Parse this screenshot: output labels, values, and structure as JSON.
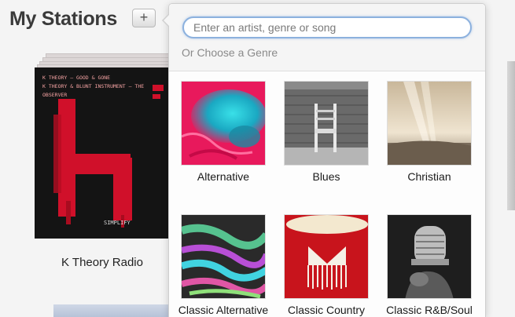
{
  "page": {
    "title": "My Stations",
    "add_label": "+"
  },
  "station": {
    "name": "K Theory Radio",
    "art_tracks": [
      "K THEORY — GOOD & GONE",
      "K THEORY & BLUNT INSTRUMENT — THE OBSERVER"
    ],
    "art_label": "SIMPLIFY"
  },
  "popover": {
    "search_placeholder": "Enter an artist, genre or song",
    "heading": "Or Choose a Genre",
    "genres": [
      {
        "label": "Alternative",
        "icon": "alternative-art"
      },
      {
        "label": "Blues",
        "icon": "blues-art"
      },
      {
        "label": "Christian",
        "icon": "christian-art"
      },
      {
        "label": "Classic Alternative",
        "icon": "classic-alternative-art"
      },
      {
        "label": "Classic Country",
        "icon": "classic-country-art"
      },
      {
        "label": "Classic R&B/Soul",
        "icon": "classic-rnb-soul-art"
      }
    ]
  },
  "colors": {
    "accent": "#8cb1de",
    "station_red": "#e0102a"
  }
}
